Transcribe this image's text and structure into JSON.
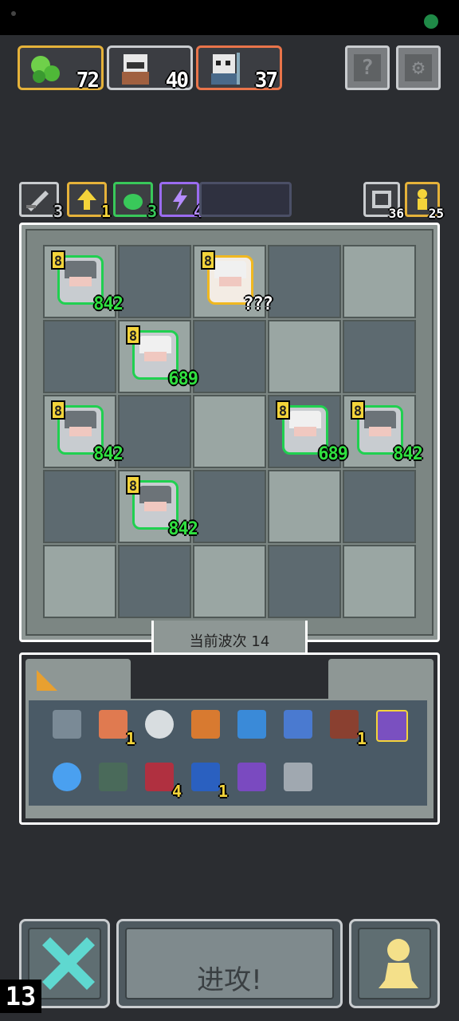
{
  "resources": [
    {
      "name": "green-slime-resource",
      "value": "72",
      "border": "#e5b23a"
    },
    {
      "name": "white-bandit-resource",
      "value": "40",
      "border": "#c9cccf"
    },
    {
      "name": "skeleton-mage-resource",
      "value": "37",
      "border": "#e9744a"
    }
  ],
  "top_buttons": {
    "help": "?",
    "settings": "⚙"
  },
  "buffs": [
    {
      "icon": "sword-icon",
      "count": "3",
      "color": "#c9cccf"
    },
    {
      "icon": "arrow-up-icon",
      "count": "1",
      "color": "#e5b23a"
    },
    {
      "icon": "slime-icon",
      "count": "3",
      "color": "#39c85a"
    },
    {
      "icon": "lightning-icon",
      "count": "4",
      "color": "#9b6cf0"
    }
  ],
  "counters": {
    "refresh": "36",
    "pawn": "25"
  },
  "units": [
    {
      "name": "knight-unit",
      "level": "8",
      "hp": "842"
    },
    {
      "name": "princess-unit",
      "level": "8",
      "hp": "???"
    },
    {
      "name": "priest-unit",
      "level": "8",
      "hp": "689"
    },
    {
      "name": "knight-unit",
      "level": "8",
      "hp": "842"
    },
    {
      "name": "priest-unit",
      "level": "8",
      "hp": "689"
    },
    {
      "name": "knight-unit",
      "level": "8",
      "hp": "842"
    },
    {
      "name": "knight-unit",
      "level": "8",
      "hp": "842"
    }
  ],
  "wave": {
    "label": "当前波次 14"
  },
  "inventory": [
    {
      "icon": "hammer-icon",
      "count": ""
    },
    {
      "icon": "potion-jar-icon",
      "count": "1"
    },
    {
      "icon": "mirror-icon",
      "count": ""
    },
    {
      "icon": "fire-scroll-icon",
      "count": ""
    },
    {
      "icon": "water-swirl-icon",
      "count": ""
    },
    {
      "icon": "wind-swirl-icon",
      "count": ""
    },
    {
      "icon": "boot-icon",
      "count": "1"
    },
    {
      "icon": "staff-icon",
      "count": ""
    },
    {
      "icon": "crystal-ball-icon",
      "count": ""
    },
    {
      "icon": "beast-mask-icon",
      "count": ""
    },
    {
      "icon": "demon-mask-icon",
      "count": "4"
    },
    {
      "icon": "hourglass-icon",
      "count": "1"
    },
    {
      "icon": "bat-wings-icon",
      "count": ""
    },
    {
      "icon": "dagger-icon",
      "count": ""
    }
  ],
  "actions": {
    "attack": "进攻!",
    "round": "13"
  },
  "colors": {
    "hp_green": "#30e040",
    "level_yellow": "#f4d43a"
  }
}
